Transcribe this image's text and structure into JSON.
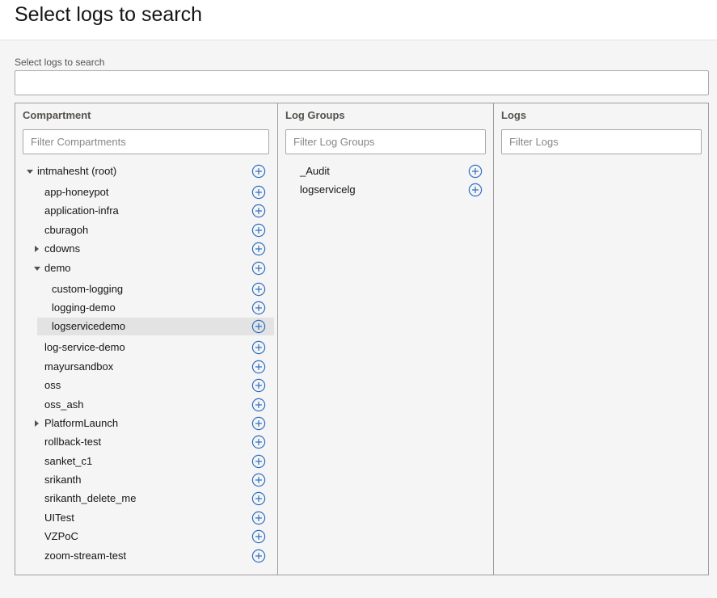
{
  "page": {
    "title": "Select logs to search"
  },
  "search": {
    "label": "Select logs to search",
    "value": ""
  },
  "columns": {
    "compartment": {
      "header": "Compartment",
      "filter_placeholder": "Filter Compartments"
    },
    "log_groups": {
      "header": "Log Groups",
      "filter_placeholder": "Filter Log Groups"
    },
    "logs": {
      "header": "Logs",
      "filter_placeholder": "Filter Logs"
    }
  },
  "compartments": [
    {
      "label": "intmahesht (root)",
      "level": 0,
      "caret": "down",
      "selected": false
    },
    {
      "label": "app-honeypot",
      "level": 1,
      "caret": "",
      "selected": false
    },
    {
      "label": "application-infra",
      "level": 1,
      "caret": "",
      "selected": false
    },
    {
      "label": "cburagoh",
      "level": 1,
      "caret": "",
      "selected": false
    },
    {
      "label": "cdowns",
      "level": 1,
      "caret": "right",
      "selected": false
    },
    {
      "label": "demo",
      "level": 1,
      "caret": "down",
      "selected": false
    },
    {
      "label": "custom-logging",
      "level": 2,
      "caret": "",
      "selected": false
    },
    {
      "label": "logging-demo",
      "level": 2,
      "caret": "",
      "selected": false
    },
    {
      "label": "logservicedemo",
      "level": 2,
      "caret": "",
      "selected": true
    },
    {
      "label": "log-service-demo",
      "level": 1,
      "caret": "",
      "selected": false
    },
    {
      "label": "mayursandbox",
      "level": 1,
      "caret": "",
      "selected": false
    },
    {
      "label": "oss",
      "level": 1,
      "caret": "",
      "selected": false
    },
    {
      "label": "oss_ash",
      "level": 1,
      "caret": "",
      "selected": false
    },
    {
      "label": "PlatformLaunch",
      "level": 1,
      "caret": "right",
      "selected": false
    },
    {
      "label": "rollback-test",
      "level": 1,
      "caret": "",
      "selected": false
    },
    {
      "label": "sanket_c1",
      "level": 1,
      "caret": "",
      "selected": false
    },
    {
      "label": "srikanth",
      "level": 1,
      "caret": "",
      "selected": false
    },
    {
      "label": "srikanth_delete_me",
      "level": 1,
      "caret": "",
      "selected": false
    },
    {
      "label": "UITest",
      "level": 1,
      "caret": "",
      "selected": false
    },
    {
      "label": "VZPoC",
      "level": 1,
      "caret": "",
      "selected": false
    },
    {
      "label": "zoom-stream-test",
      "level": 1,
      "caret": "",
      "selected": false
    }
  ],
  "log_groups": [
    {
      "label": "_Audit"
    },
    {
      "label": "logservicelg"
    }
  ],
  "logs": [],
  "icons": {
    "add": "plus-circle-icon",
    "expanded": "caret-down-icon",
    "collapsed": "caret-right-icon"
  },
  "colors": {
    "accent": "#2b6dc2",
    "selected_row": "#e3e3e3"
  }
}
